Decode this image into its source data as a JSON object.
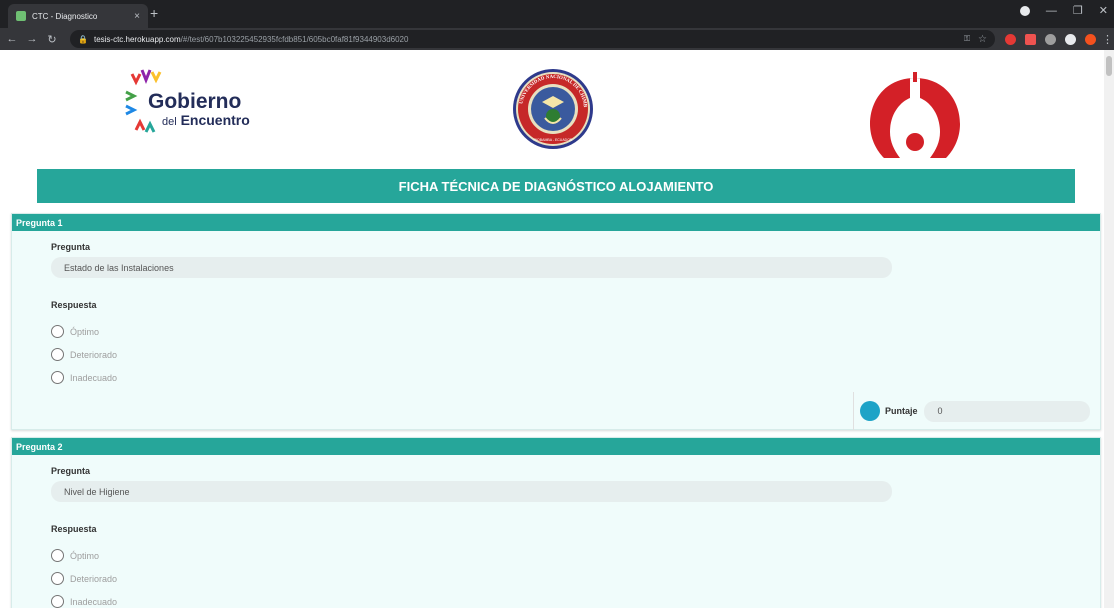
{
  "browser": {
    "tab_title": "CTC - Diagnostico",
    "tab_close": "×",
    "new_tab": "+",
    "url_host": "tesis-ctc.herokuapp.com",
    "url_path": "/#/test/607b103225452935fcfdb851/605bc0faf81f9344903d6020"
  },
  "logos": {
    "gobierno_title": "Gobierno",
    "gobierno_sub_prefix": "del",
    "gobierno_sub": "Encuentro",
    "university_seal": "UNIVERSIDAD NACIONAL DE CHIMBORAZO",
    "university_seal_bottom": "RIOBAMBA - ECUADOR"
  },
  "banner": {
    "title": "FICHA TÉCNICA DE DIAGNÓSTICO ALOJAMIENTO"
  },
  "questions": [
    {
      "header": "Pregunta 1",
      "pregunta_label": "Pregunta",
      "pregunta_value": "Estado de las Instalaciones",
      "respuesta_label": "Respuesta",
      "options": [
        "Óptimo",
        "Deteriorado",
        "Inadecuado"
      ],
      "puntaje_label": "Puntaje",
      "puntaje_value": "0"
    },
    {
      "header": "Pregunta 2",
      "pregunta_label": "Pregunta",
      "pregunta_value": "Nivel de Higiene",
      "respuesta_label": "Respuesta",
      "options": [
        "Óptimo",
        "Deteriorado",
        "Inadecuado"
      ]
    }
  ],
  "colors": {
    "accent": "#26a69a",
    "card_bg": "#f0fcfb",
    "score_dot": "#1ea3c7",
    "ctc_red": "#d32027",
    "gobierno_navy": "#232d59"
  }
}
